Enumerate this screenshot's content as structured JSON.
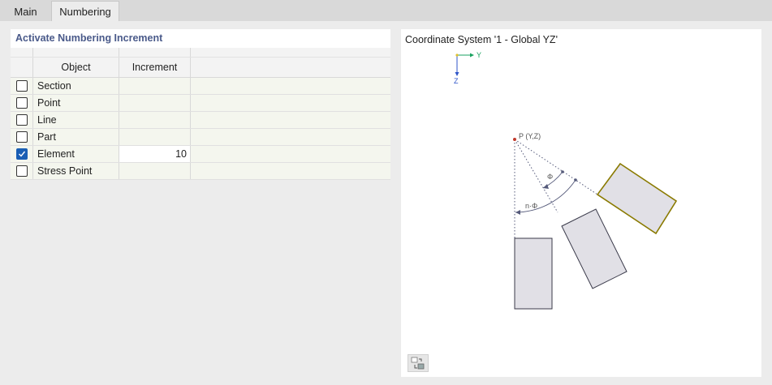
{
  "tabs": [
    {
      "label": "Main",
      "active": false
    },
    {
      "label": "Numbering",
      "active": true
    }
  ],
  "section": {
    "title": "Activate Numbering Increment"
  },
  "table": {
    "columns": [
      "Object",
      "Increment"
    ],
    "rows": [
      {
        "object": "Section",
        "checked": false,
        "increment": ""
      },
      {
        "object": "Point",
        "checked": false,
        "increment": ""
      },
      {
        "object": "Line",
        "checked": false,
        "increment": ""
      },
      {
        "object": "Part",
        "checked": false,
        "increment": ""
      },
      {
        "object": "Element",
        "checked": true,
        "increment": "10"
      },
      {
        "object": "Stress Point",
        "checked": false,
        "increment": ""
      }
    ]
  },
  "diagram": {
    "title": "Coordinate System '1 - Global YZ'",
    "axis_y": "Y",
    "axis_z": "Z",
    "point_label": "P (Y,Z)",
    "phi_label": "Φ",
    "nphi_label": "n·Φ",
    "colors": {
      "axis_y": "#1aa260",
      "axis_z": "#2f55c8",
      "highlight_edge": "#8a7a00",
      "rect_fill": "#e1e0e6",
      "point": "#c0392b"
    },
    "settings_button_icon": "view-settings-icon"
  }
}
